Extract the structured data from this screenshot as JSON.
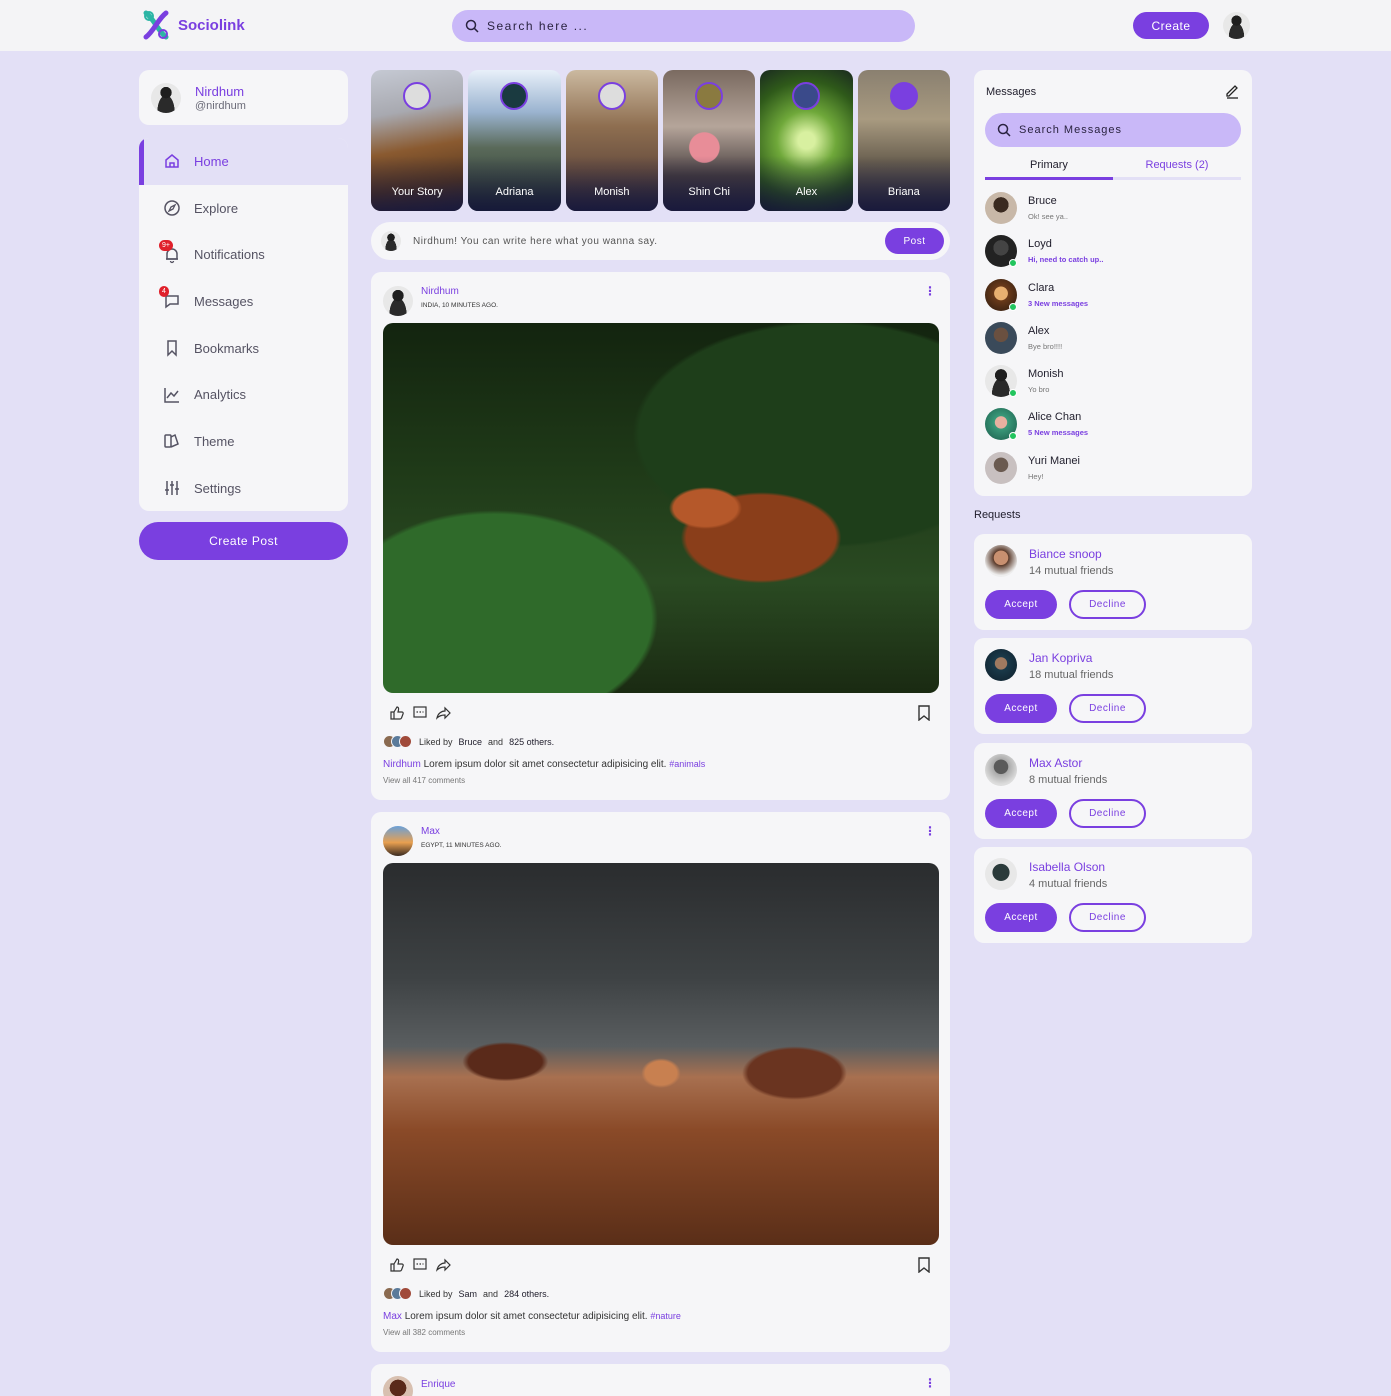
{
  "brand": {
    "name": "Sociolink",
    "accent": "#7a3fe0",
    "soft": "#c9b8f8",
    "bg": "#e3e0f6"
  },
  "topbar": {
    "search_placeholder": "Search here ...",
    "create_label": "Create"
  },
  "profile": {
    "name": "Nirdhum",
    "handle": "@nirdhum"
  },
  "nav": [
    {
      "label": "Home",
      "icon": "home-icon",
      "active": true
    },
    {
      "label": "Explore",
      "icon": "compass-icon"
    },
    {
      "label": "Notifications",
      "icon": "bell-icon",
      "badge": "9+"
    },
    {
      "label": "Messages",
      "icon": "message-icon",
      "badge": "4"
    },
    {
      "label": "Bookmarks",
      "icon": "bookmark-icon"
    },
    {
      "label": "Analytics",
      "icon": "chart-icon"
    },
    {
      "label": "Theme",
      "icon": "palette-icon"
    },
    {
      "label": "Settings",
      "icon": "sliders-icon"
    }
  ],
  "create_post_label": "Create Post",
  "stories": [
    {
      "name": "Your Story"
    },
    {
      "name": "Adriana"
    },
    {
      "name": "Monish"
    },
    {
      "name": "Shin Chi"
    },
    {
      "name": "Alex"
    },
    {
      "name": "Briana"
    }
  ],
  "composer": {
    "placeholder": "Nirdhum! You can write here what you wanna say.",
    "post_label": "Post"
  },
  "feed": [
    {
      "user": "Nirdhum",
      "location": "INDIA, 10 MINUTES AGO.",
      "liked_by": "Bruce",
      "liked_others": "825 others.",
      "caption_user": "Nirdhum",
      "caption": "Lorem ipsum dolor sit amet consectetur adipisicing elit.",
      "tag": "#animals",
      "comments": "View all 417 comments"
    },
    {
      "user": "Max",
      "location": "EGYPT, 11 MINUTES AGO.",
      "liked_by": "Sam",
      "liked_others": "284 others.",
      "caption_user": "Max",
      "caption": "Lorem ipsum dolor sit amet consectetur adipisicing elit.",
      "tag": "#nature",
      "comments": "View all 382 comments"
    },
    {
      "user": "Enrique"
    }
  ],
  "labels": {
    "liked_prefix": "Liked by",
    "and": "and"
  },
  "messages": {
    "title": "Messages",
    "search_placeholder": "Search Messages",
    "tabs": [
      "Primary",
      "Requests (2)"
    ],
    "list": [
      {
        "name": "Bruce",
        "text": "Ok! see ya..",
        "highlight": false,
        "online": false
      },
      {
        "name": "Loyd",
        "text": "Hi, need to catch up..",
        "highlight": true,
        "online": true
      },
      {
        "name": "Clara",
        "text": "3 New messages",
        "highlight": true,
        "online": true
      },
      {
        "name": "Alex",
        "text": "Bye bro!!!!",
        "highlight": false,
        "online": false
      },
      {
        "name": "Monish",
        "text": "Yo bro",
        "highlight": false,
        "online": true
      },
      {
        "name": "Alice Chan",
        "text": "5 New messages",
        "highlight": true,
        "online": true
      },
      {
        "name": "Yuri Manei",
        "text": "Hey!",
        "highlight": false,
        "online": false
      }
    ]
  },
  "requests": {
    "title": "Requests",
    "accept_label": "Accept",
    "decline_label": "Decline",
    "items": [
      {
        "name": "Biance snoop",
        "mutual": "14 mutual friends"
      },
      {
        "name": "Jan Kopriva",
        "mutual": "18 mutual friends"
      },
      {
        "name": "Max Astor",
        "mutual": "8 mutual friends"
      },
      {
        "name": "Isabella Olson",
        "mutual": "4 mutual friends"
      }
    ]
  }
}
